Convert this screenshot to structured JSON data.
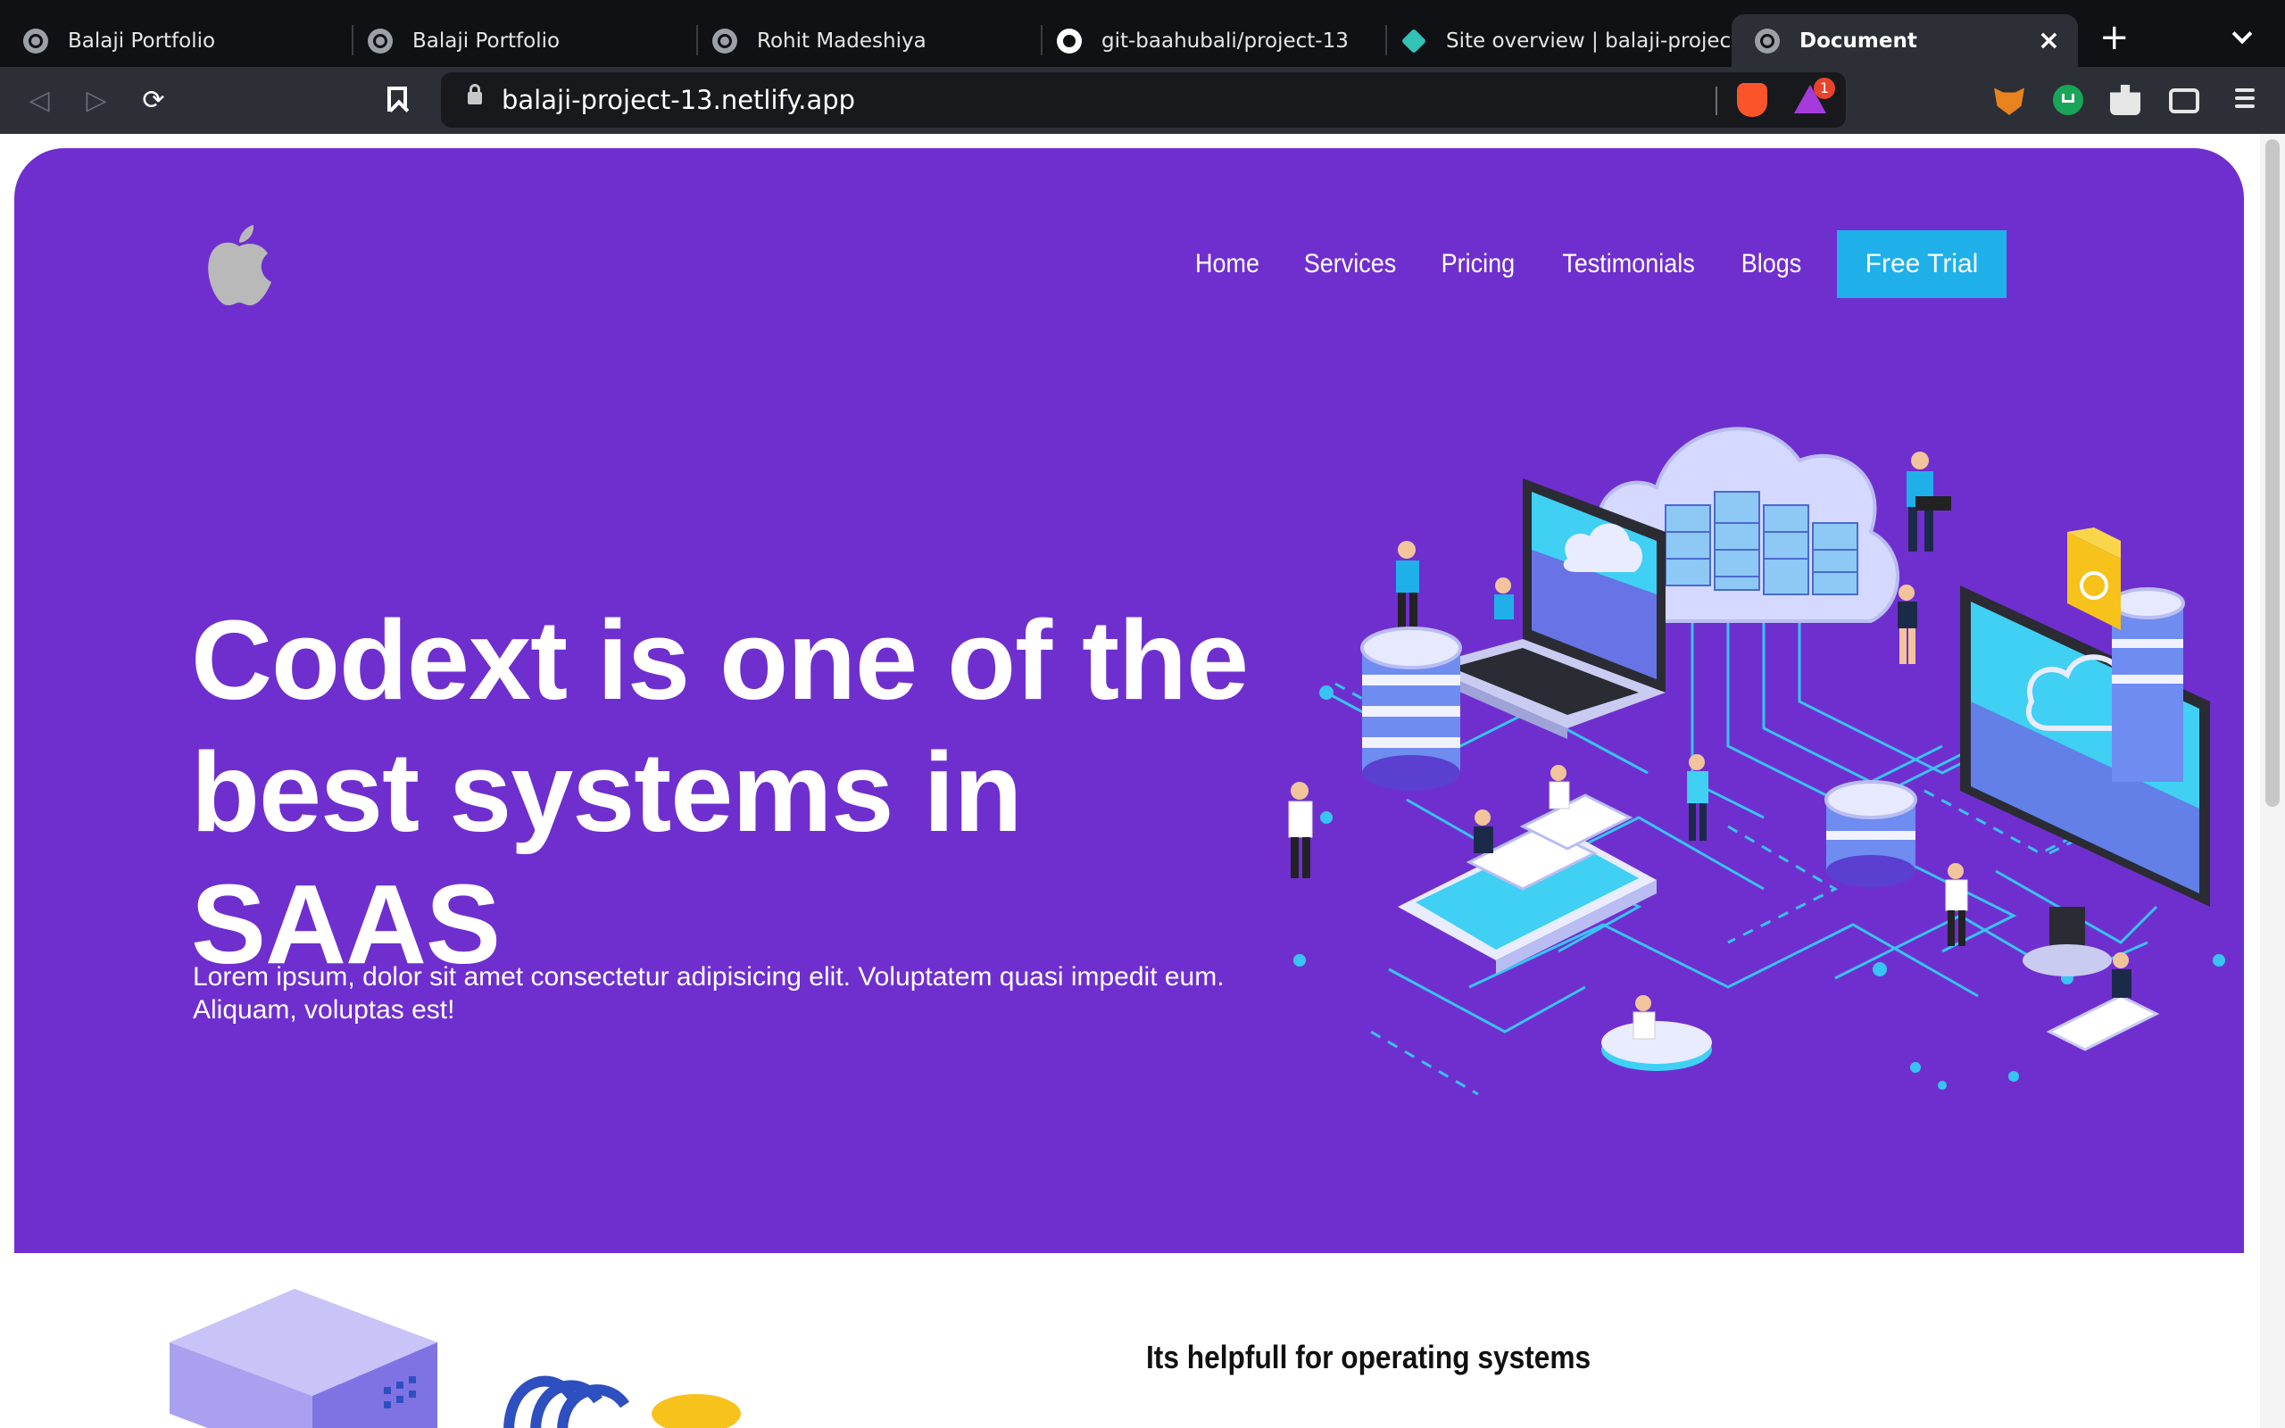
{
  "browser": {
    "tabs": [
      {
        "title": "Balaji Portfolio",
        "icon": "globe-icon"
      },
      {
        "title": "Balaji Portfolio",
        "icon": "globe-icon"
      },
      {
        "title": "Rohit Madeshiya",
        "icon": "globe-icon"
      },
      {
        "title": "git-baahubali/project-13",
        "icon": "github-icon"
      },
      {
        "title": "Site overview | balaji-projec",
        "icon": "netlify-icon"
      },
      {
        "title": "Document",
        "icon": "globe-icon",
        "active": true
      }
    ],
    "url": "balaji-project-13.netlify.app",
    "new_tab": "+",
    "close_tab": "×",
    "rewards_badge": "1"
  },
  "page": {
    "nav": {
      "links": [
        "Home",
        "Services",
        "Pricing",
        "Testimonials",
        "Blogs"
      ],
      "cta": "Free Trial"
    },
    "hero": {
      "headline_line1": "Codext is one of the",
      "headline_line2": "best systems in SAAS",
      "subtext": "Lorem ipsum, dolor sit amet consectetur adipisicing elit. Voluptatem quasi impedit eum. Aliquam, voluptas est!"
    },
    "section2": {
      "heading": "Its helpfull for operating systems"
    },
    "colors": {
      "hero_bg": "#6f2fcf",
      "cta_bg": "#1fb0ea",
      "chrome_bg": "#2c2f36"
    }
  }
}
